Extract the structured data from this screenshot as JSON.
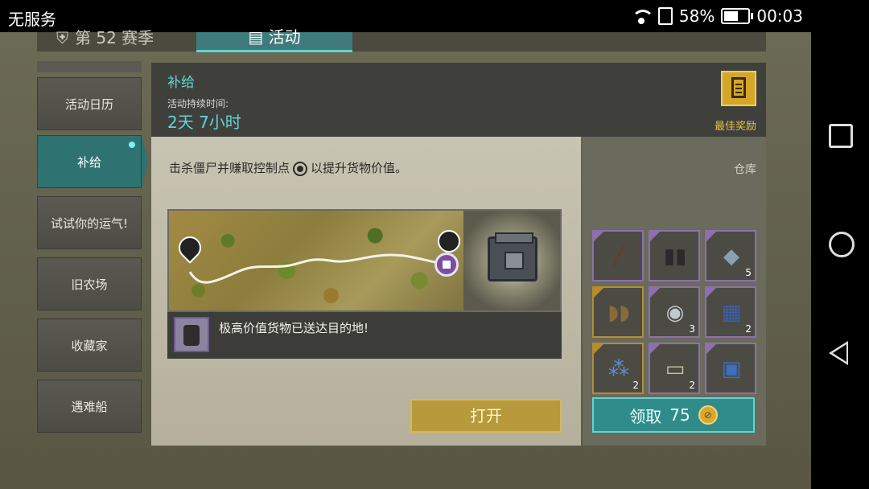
{
  "status": {
    "carrier": "无服务",
    "battery": "58%",
    "battery_level": 0.58,
    "time": "00:03"
  },
  "tabs": {
    "season": "第 52 赛季",
    "activity": "活动"
  },
  "sidebar": {
    "items": [
      {
        "label": "活动日历"
      },
      {
        "label": "补给",
        "active": true
      },
      {
        "label": "试试你的运气!"
      },
      {
        "label": "旧农场"
      },
      {
        "label": "收藏家"
      },
      {
        "label": "遇难船"
      }
    ]
  },
  "header": {
    "title": "补给",
    "duration_label": "活动持续时间:",
    "duration": "2天 7小时",
    "reward_label": "最佳奖励"
  },
  "main": {
    "description_part1": "击杀僵尸并赚取控制点",
    "description_part2": "以提升货物价值。",
    "message": "极高价值货物已送达目的地!",
    "open_button": "打开"
  },
  "storage": {
    "label": "仓库",
    "items": [
      {
        "name": "rifle-icon",
        "count": "",
        "rarity": "purple"
      },
      {
        "name": "boots-icon",
        "count": "",
        "rarity": "purple"
      },
      {
        "name": "metal-plate-icon",
        "count": "5",
        "rarity": "purple"
      },
      {
        "name": "shoes-icon",
        "count": "",
        "rarity": "gold"
      },
      {
        "name": "lens-icon",
        "count": "3",
        "rarity": "purple"
      },
      {
        "name": "circuit-board-icon",
        "count": "2",
        "rarity": "purple"
      },
      {
        "name": "components-icon",
        "count": "2",
        "rarity": "gold"
      },
      {
        "name": "explosive-icon",
        "count": "2",
        "rarity": "purple"
      },
      {
        "name": "blueprint-icon",
        "count": "",
        "rarity": "purple"
      }
    ]
  },
  "claim": {
    "label": "领取",
    "amount": "75"
  },
  "colors": {
    "accent": "#5fd6d4",
    "gold": "#d4a62a",
    "purple": "#8e6fb0"
  }
}
